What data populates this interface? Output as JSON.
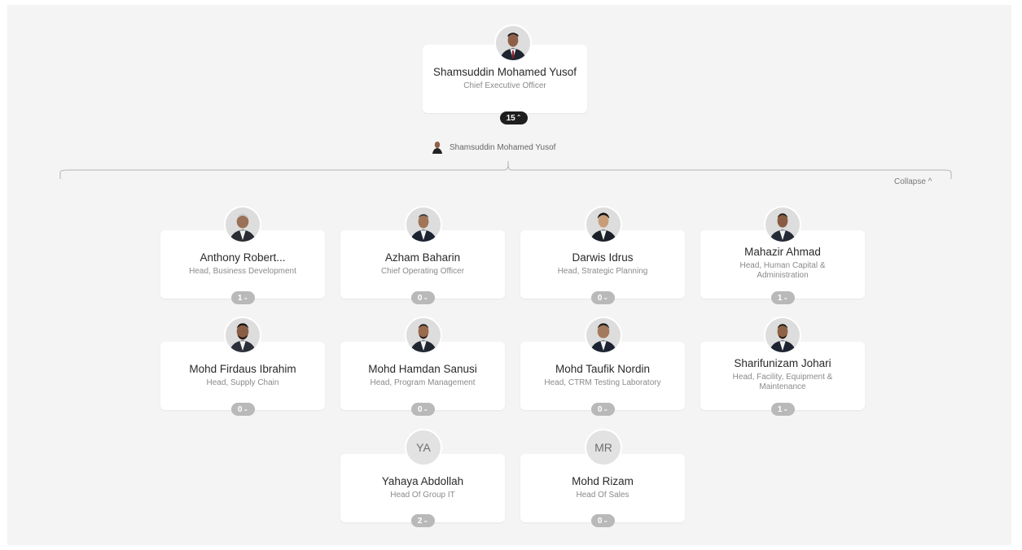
{
  "root": {
    "name": "Shamsuddin Mohamed Yusof",
    "title": "Chief Executive Officer",
    "count": "15",
    "chevron": "^",
    "avatar_icon": "person-photo-icon"
  },
  "manager_label": {
    "name": "Shamsuddin Mohamed Yusof",
    "icon": "person-mini-icon"
  },
  "collapse_label": "Collapse ^",
  "reports": [
    {
      "name": "Anthony Robert...",
      "title": "Head, Business Development",
      "count": "1",
      "chevron": "v",
      "initials": ""
    },
    {
      "name": "Azham Baharin",
      "title": "Chief Operating Officer",
      "count": "0",
      "chevron": "v",
      "initials": ""
    },
    {
      "name": "Darwis Idrus",
      "title": "Head, Strategic Planning",
      "count": "0",
      "chevron": "v",
      "initials": ""
    },
    {
      "name": "Mahazir Ahmad",
      "title": "Head, Human Capital & Administration",
      "count": "1",
      "chevron": "v",
      "initials": ""
    },
    {
      "name": "Mohd Firdaus Ibrahim",
      "title": "Head, Supply Chain",
      "count": "0",
      "chevron": "v",
      "initials": ""
    },
    {
      "name": "Mohd Hamdan Sanusi",
      "title": "Head, Program Management",
      "count": "0",
      "chevron": "v",
      "initials": ""
    },
    {
      "name": "Mohd Taufik Nordin",
      "title": "Head, CTRM Testing Laboratory",
      "count": "0",
      "chevron": "v",
      "initials": ""
    },
    {
      "name": "Sharifunizam Johari",
      "title": "Head, Facility, Equipment & Maintenance",
      "count": "1",
      "chevron": "v",
      "initials": ""
    },
    {
      "name": "Yahaya Abdollah",
      "title": "Head Of Group IT",
      "count": "2",
      "chevron": "v",
      "initials": "YA"
    },
    {
      "name": "Mohd Rizam",
      "title": "Head Of Sales",
      "count": "0",
      "chevron": "v",
      "initials": "MR"
    }
  ],
  "colors": {
    "canvas": "#f4f4f4",
    "card": "#ffffff",
    "badge_grey": "#b9b9b9",
    "badge_dark": "#1e1e1e"
  }
}
